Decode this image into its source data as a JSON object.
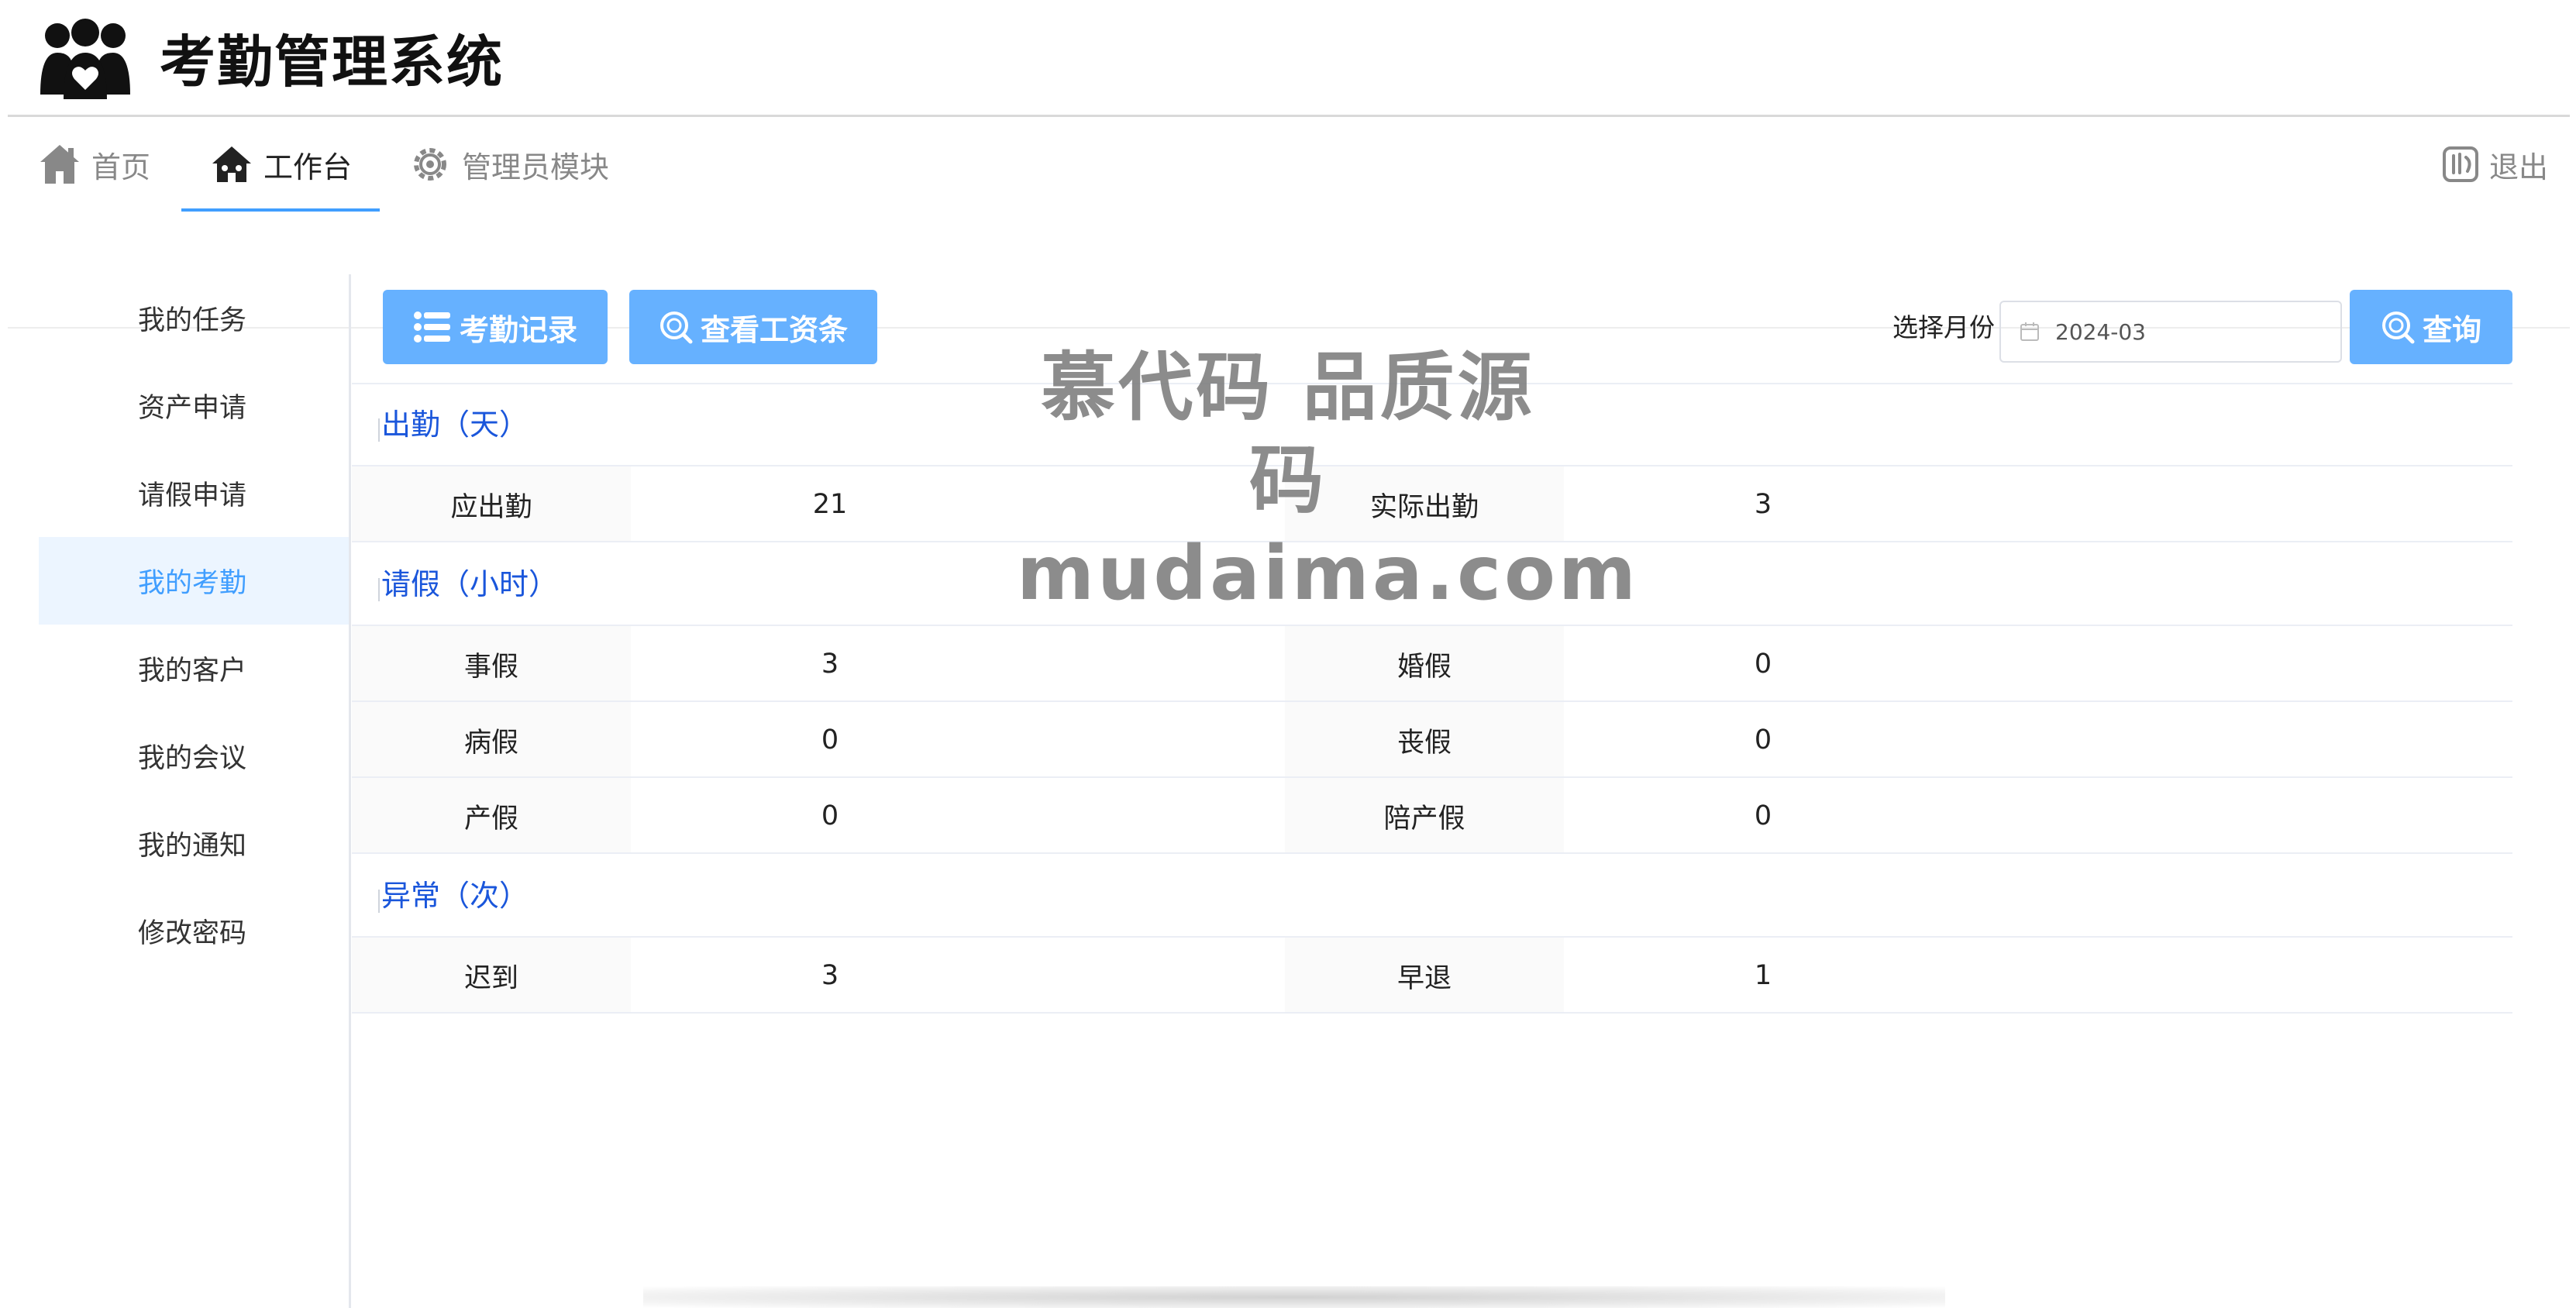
{
  "app": {
    "title": "考勤管理系统"
  },
  "nav": {
    "items": [
      {
        "label": "首页",
        "icon": "home-icon"
      },
      {
        "label": "工作台",
        "icon": "workbench-icon",
        "active": true
      },
      {
        "label": "管理员模块",
        "icon": "gear-icon"
      }
    ],
    "logout": {
      "label": "退出",
      "icon": "logout-icon"
    }
  },
  "sidebar": {
    "items": [
      {
        "label": "我的任务"
      },
      {
        "label": "资产申请"
      },
      {
        "label": "请假申请"
      },
      {
        "label": "我的考勤",
        "active": true
      },
      {
        "label": "我的客户"
      },
      {
        "label": "我的会议"
      },
      {
        "label": "我的通知"
      },
      {
        "label": "修改密码"
      }
    ]
  },
  "toolbar": {
    "attendance_records_label": "考勤记录",
    "view_payslip_label": "查看工资条",
    "month_label": "选择月份",
    "month_value": "2024-03",
    "query_label": "查询"
  },
  "attendance": {
    "title": "出勤（天）",
    "rows": [
      {
        "k1": "应出勤",
        "v1": "21",
        "k2": "实际出勤",
        "v2": "3"
      }
    ]
  },
  "leave": {
    "title": "请假（小时）",
    "rows": [
      {
        "k1": "事假",
        "v1": "3",
        "k2": "婚假",
        "v2": "0"
      },
      {
        "k1": "病假",
        "v1": "0",
        "k2": "丧假",
        "v2": "0"
      },
      {
        "k1": "产假",
        "v1": "0",
        "k2": "陪产假",
        "v2": "0"
      }
    ]
  },
  "abnormal": {
    "title": "异常（次）",
    "rows": [
      {
        "k1": "迟到",
        "v1": "3",
        "k2": "早退",
        "v2": "1"
      }
    ]
  },
  "watermark": {
    "line1": "慕代码 品质源码",
    "line2": "mudaima.com"
  },
  "colors": {
    "primary": "#409eff",
    "button": "#66b1ff",
    "section_title": "#1a56db",
    "active_bg": "#ecf5ff"
  }
}
